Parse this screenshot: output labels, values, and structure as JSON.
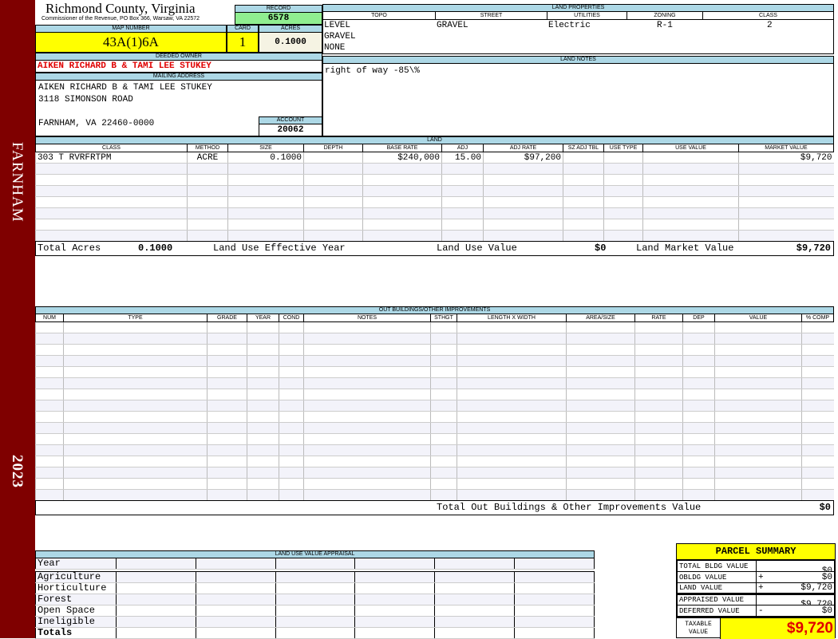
{
  "sidebar": {
    "district": "FARNHAM",
    "year": "2023"
  },
  "header": {
    "title": "Richmond County, Virginia",
    "subtitle": "Commissioner of the Revenue, PO Box 366, Warsaw, VA 22572",
    "record_label": "RECORD",
    "record": "6578"
  },
  "parcel": {
    "map_label": "MAP NUMBER",
    "map_number": "43A(1)6A",
    "card_label": "CARD",
    "card": "1",
    "acres_label": "ACRES",
    "acres": "0.1000"
  },
  "owner": {
    "deeded_label": "DEEDED OWNER",
    "deeded": "AIKEN RICHARD B & TAMI LEE STUKEY",
    "mailing_label": "MAILING ADDRESS",
    "line1": "AIKEN RICHARD B & TAMI LEE STUKEY",
    "line2": "3118 SIMONSON ROAD",
    "line3": "FARNHAM, VA 22460-0000",
    "account_label": "ACCOUNT",
    "account": "20062"
  },
  "land_properties": {
    "label": "LAND PROPERTIES",
    "headers": [
      "TOPO",
      "STREET",
      "UTILITIES",
      "ZONING",
      "CLASS"
    ],
    "topo": [
      "LEVEL",
      "GRAVEL",
      "NONE"
    ],
    "street": "GRAVEL",
    "utilities": "Electric",
    "zoning": "R-1",
    "class": "2"
  },
  "land_notes": {
    "label": "LAND NOTES",
    "text": "right of way -85\\%"
  },
  "land": {
    "label": "LAND",
    "headers": [
      "CLASS",
      "METHOD",
      "SIZE",
      "DEPTH",
      "BASE RATE",
      "ADJ",
      "ADJ RATE",
      "SZ ADJ TBL",
      "USE TYPE",
      "USE VALUE",
      "MARKET VALUE"
    ],
    "rows": [
      [
        "303 T RVRFRTPM",
        "ACRE",
        "0.1000",
        "",
        "$240,000",
        "15.00",
        "$97,200",
        "",
        "",
        "",
        "$9,720"
      ]
    ],
    "total_acres_label": "Total Acres",
    "total_acres": "0.1000",
    "effective_year_label": "Land Use Effective Year",
    "use_value_label": "Land Use Value",
    "use_value": "$0",
    "market_value_label": "Land Market Value",
    "market_value": "$9,720"
  },
  "outbuildings": {
    "label": "OUT BUILDINGS/OTHER IMPROVEMENTS",
    "headers": [
      "NUM",
      "TYPE",
      "GRADE",
      "YEAR",
      "COND",
      "NOTES",
      "STHGT",
      "LENGTH X WIDTH",
      "AREA/SIZE",
      "RATE",
      "DEP",
      "VALUE",
      "% COMP"
    ],
    "total_label": "Total Out Buildings & Other Improvements Value",
    "total": "$0"
  },
  "land_use": {
    "label": "LAND USE VALUE APPRAISAL",
    "year_label": "Year",
    "rows": [
      "Agriculture",
      "Horticulture",
      "Forest",
      "Open Space",
      "Ineligible"
    ],
    "totals_label": "Totals"
  },
  "summary": {
    "title": "PARCEL SUMMARY",
    "rows": [
      {
        "label": "TOTAL BLDG VALUE",
        "sign": "",
        "value": "$0"
      },
      {
        "label": "OBLDG VALUE",
        "sign": "+",
        "value": "$0"
      },
      {
        "label": "LAND VALUE",
        "sign": "+",
        "value": "$9,720"
      },
      {
        "label": "APPRAISED VALUE",
        "sign": "",
        "value": "$9,720"
      },
      {
        "label": "DEFERRED VALUE",
        "sign": "-",
        "value": "$0"
      }
    ],
    "taxable_label": "TAXABLE VALUE",
    "taxable": "$9,720"
  },
  "colors": {
    "sidebar": "#7f0000",
    "header_label": "#add8e6",
    "highlight": "#ffff00",
    "record": "#90ee90",
    "owner": "#e00000"
  }
}
